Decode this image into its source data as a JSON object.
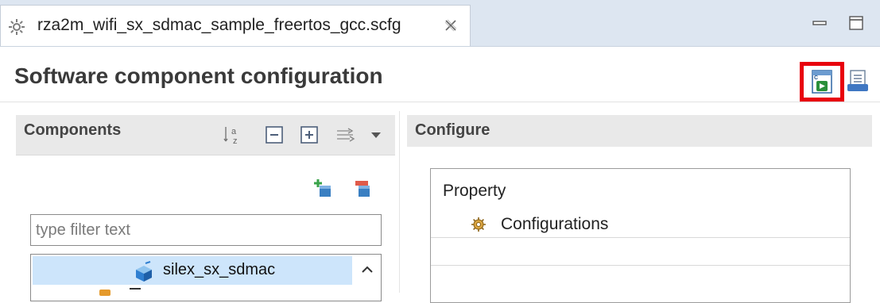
{
  "editor": {
    "tab_title": "rza2m_wifi_sx_sdmac_sample_freertos_gcc.scfg",
    "tab_icon": "gear-icon",
    "close_icon": "close-icon"
  },
  "window_controls": {
    "minimize_icon": "minimize-icon",
    "maximize_icon": "maximize-icon"
  },
  "header": {
    "title": "Software component configuration",
    "generate_icon": "generate-code-icon",
    "report_icon": "report-icon",
    "highlight_color": "#e8000d"
  },
  "components_panel": {
    "title": "Components",
    "tools": [
      "sort-alpha-icon",
      "collapse-all-icon",
      "expand-all-icon",
      "filter-view-icon",
      "view-menu-icon"
    ],
    "add_icon": "add-component-icon",
    "remove_icon": "remove-component-icon",
    "filter_placeholder": "type filter text",
    "tree": [
      {
        "label": "silex_sx_sdmac",
        "selected": true,
        "icon": "component-cube-icon"
      }
    ]
  },
  "configure_panel": {
    "title": "Configure",
    "property_header": "Property",
    "rows": [
      {
        "label": "Configurations",
        "icon": "gear-icon"
      }
    ]
  },
  "colors": {
    "tabbar_bg": "#dde6f1",
    "panel_header_bg": "#e9e9e9",
    "selection_bg": "#cde5fb"
  }
}
